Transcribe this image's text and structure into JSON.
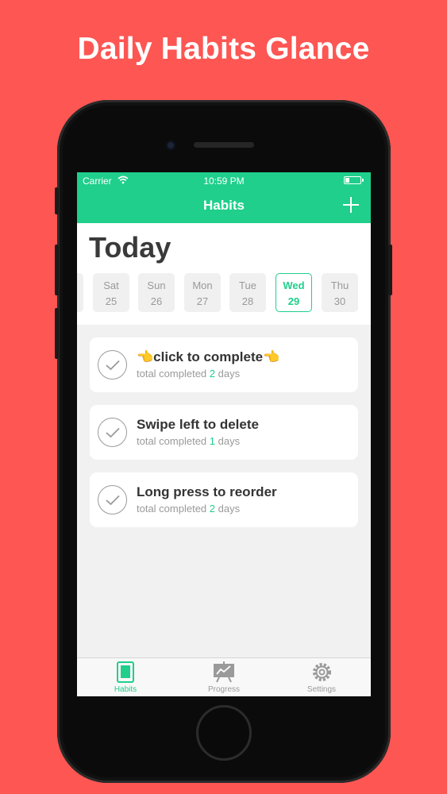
{
  "headline": "Daily Habits Glance",
  "status": {
    "carrier": "Carrier",
    "time": "10:59 PM"
  },
  "nav": {
    "title": "Habits"
  },
  "today": {
    "title": "Today",
    "days": [
      {
        "name": "Sat",
        "date": "25"
      },
      {
        "name": "Sun",
        "date": "26"
      },
      {
        "name": "Mon",
        "date": "27"
      },
      {
        "name": "Tue",
        "date": "28"
      },
      {
        "name": "Wed",
        "date": "29",
        "active": true
      },
      {
        "name": "Thu",
        "date": "30"
      }
    ]
  },
  "habits": [
    {
      "title": "👈click to complete👈",
      "prefix": "total completed",
      "count": "2",
      "suffix": "days"
    },
    {
      "title": "Swipe left to delete",
      "prefix": "total completed",
      "count": "1",
      "suffix": "days"
    },
    {
      "title": "Long press to reorder",
      "prefix": "total completed",
      "count": "2",
      "suffix": "days"
    }
  ],
  "tabs": [
    {
      "label": "Habits",
      "icon": "habits-icon",
      "active": true
    },
    {
      "label": "Progress",
      "icon": "progress-chart-icon"
    },
    {
      "label": "Settings",
      "icon": "gear-icon"
    }
  ],
  "colors": {
    "background": "#fd5653",
    "accent": "#1fcf8b"
  }
}
